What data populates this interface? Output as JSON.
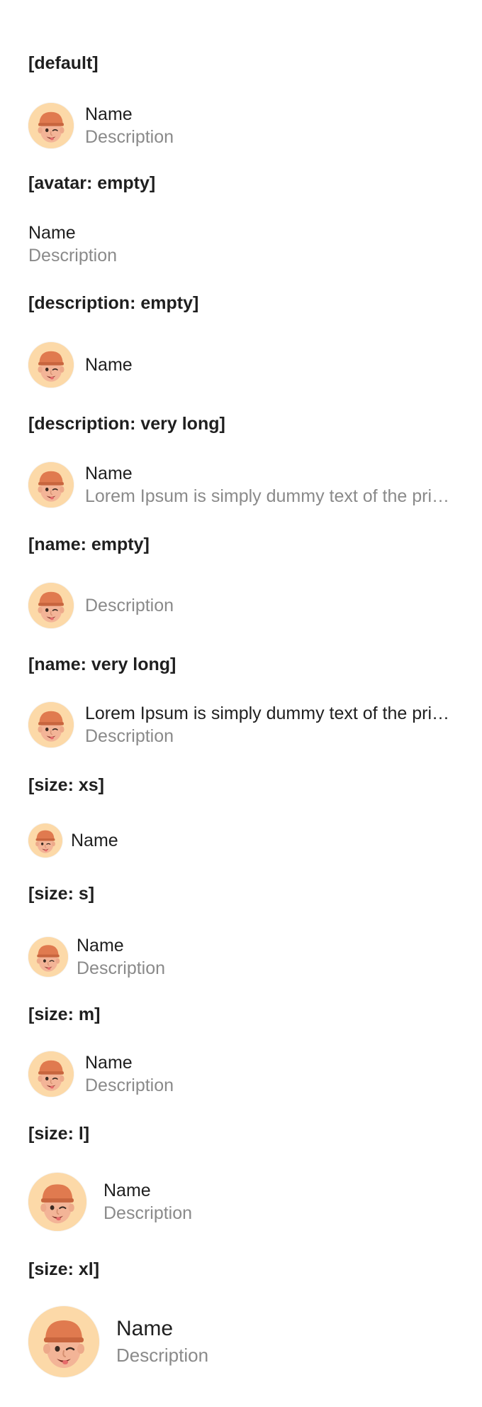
{
  "sections": [
    {
      "heading": "[default]",
      "name": "Name",
      "description": "Description"
    },
    {
      "heading": "[avatar: empty]",
      "name": "Name",
      "description": "Description"
    },
    {
      "heading": "[description: empty]",
      "name": "Name"
    },
    {
      "heading": "[description: very long]",
      "name": "Name",
      "description": "Lorem Ipsum is simply dummy text of the printing and typesetting industry. Lorem Ipsum has been the industry's standard dummy text ever since the 1500s"
    },
    {
      "heading": "[name: empty]",
      "description": "Description"
    },
    {
      "heading": "[name: very long]",
      "name": "Lorem Ipsum is simply dummy text of the printing and typesetting industry. Lorem Ipsum has been the industry's standard dummy text ever since the 1500s",
      "description": "Description"
    },
    {
      "heading": "[size: xs]",
      "name": "Name"
    },
    {
      "heading": "[size: s]",
      "name": "Name",
      "description": "Description"
    },
    {
      "heading": "[size: m]",
      "name": "Name",
      "description": "Description"
    },
    {
      "heading": "[size: l]",
      "name": "Name",
      "description": "Description"
    },
    {
      "heading": "[size: xl]",
      "name": "Name",
      "description": "Description"
    }
  ],
  "colors": {
    "text": "#1f1f1f",
    "description": "#8a8a8a",
    "avatar_bg": "#fcd9a8",
    "hat": "#e07a4f"
  },
  "icons": {
    "avatar": "memoji-avatar-icon"
  }
}
